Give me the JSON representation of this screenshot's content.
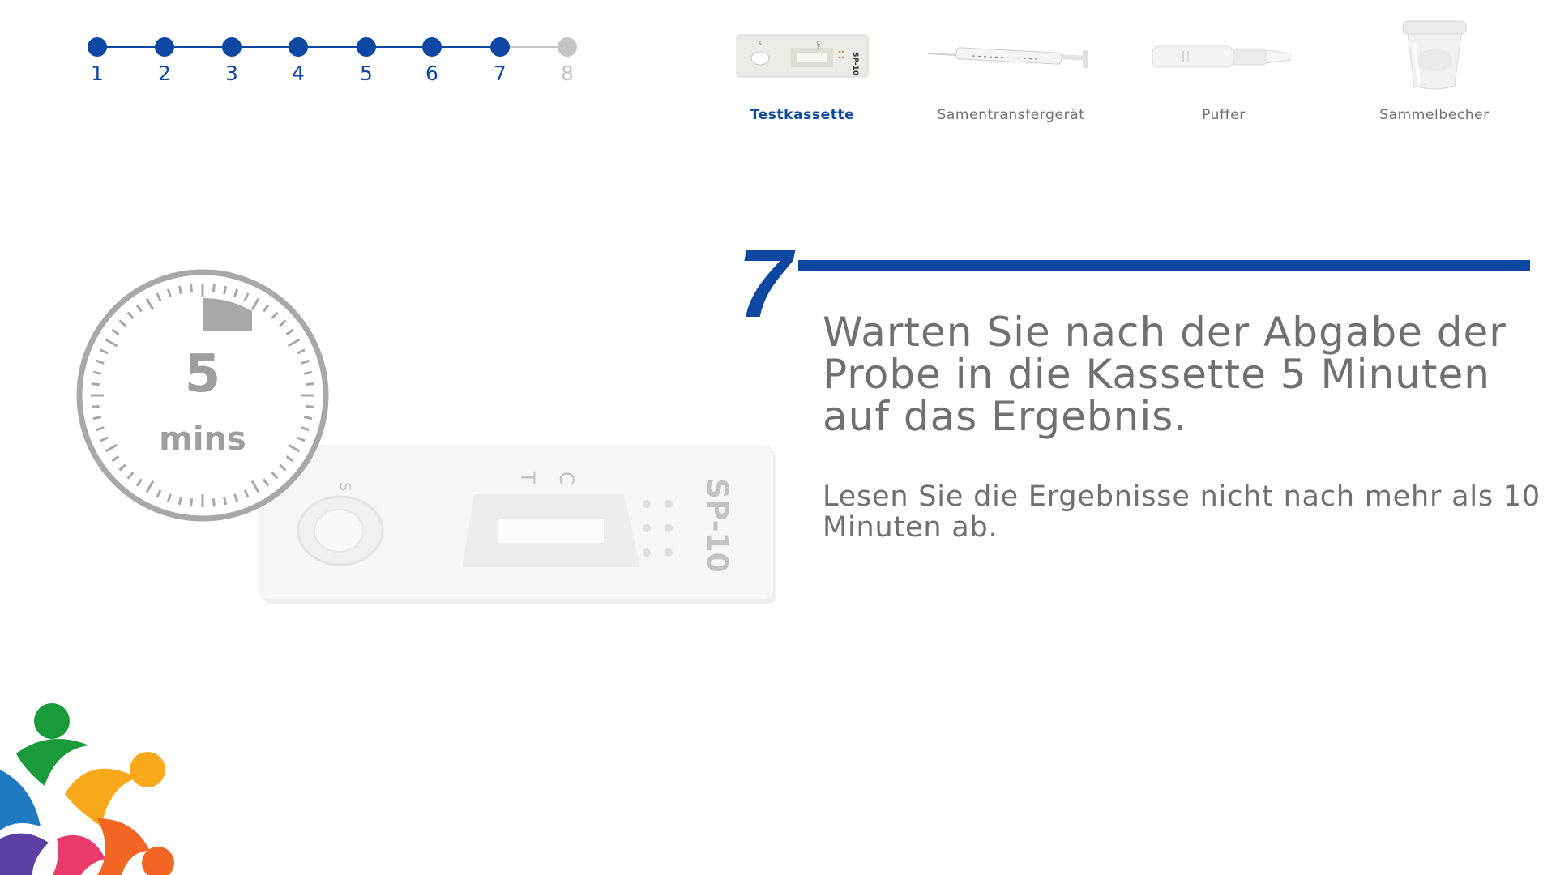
{
  "stepper": {
    "steps": [
      "1",
      "2",
      "3",
      "4",
      "5",
      "6",
      "7",
      "8"
    ],
    "current_step": 7,
    "active_color": "#0d47a1",
    "inactive_color": "#c4c4c4"
  },
  "materials": [
    {
      "label": "Testkassette",
      "icon": "test-cassette-icon",
      "active": true
    },
    {
      "label": "Samentransfergerät",
      "icon": "syringe-icon",
      "active": false
    },
    {
      "label": "Puffer",
      "icon": "buffer-tube-icon",
      "active": false
    },
    {
      "label": "Sammelbecher",
      "icon": "collection-cup-icon",
      "active": false
    }
  ],
  "step_content": {
    "number": "7",
    "main_text": "Warten Sie nach der Abgabe der Probe in die Kassette 5 Minuten auf das Ergebnis.",
    "sub_text": "Lesen Sie die Ergebnisse nicht nach mehr als 10 Minuten ab."
  },
  "illustration": {
    "timer_value": "5",
    "timer_unit": "mins",
    "cassette_label": "SP-10",
    "cassette_marks": {
      "sample": "S",
      "control": "C",
      "test": "T"
    }
  },
  "colors": {
    "accent": "#0d47a1",
    "text": "#707070",
    "inactive": "#c4c4c4"
  }
}
